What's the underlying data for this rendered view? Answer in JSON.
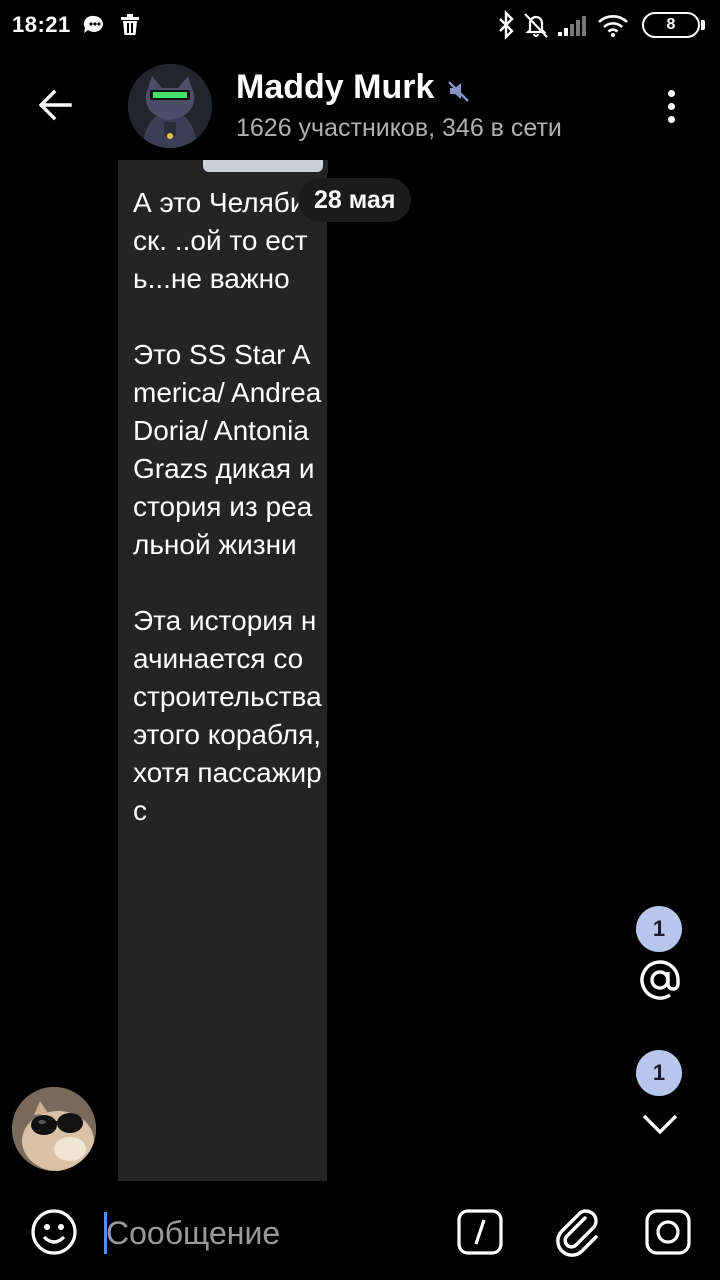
{
  "status_bar": {
    "time": "18:21",
    "battery": "8",
    "icons": [
      "chat-notification-icon",
      "delete-icon",
      "bluetooth-icon",
      "alarm-off-icon",
      "signal-icon",
      "wifi-icon",
      "battery-icon"
    ]
  },
  "header": {
    "title": "Maddy Murk",
    "subtitle": "1626 участников, 346 в сети",
    "muted": true
  },
  "date_label": "28 мая",
  "message": {
    "text": "А это Челябинск. ..ой то есть...не важно\n\nЭто SS Star America/ Andrea Doria/ Antonia Grazs дикая история из реальной жизни\n\nЭта история начинается со строительства этого корабля, хотя пассажирс"
  },
  "floating": {
    "mentions_count": "1",
    "unread_count": "1"
  },
  "input": {
    "placeholder": "Сообщение"
  },
  "colors": {
    "background": "#000000",
    "bubble": "#242424",
    "badge": "#b9c6ee",
    "caret": "#4a90ff"
  }
}
